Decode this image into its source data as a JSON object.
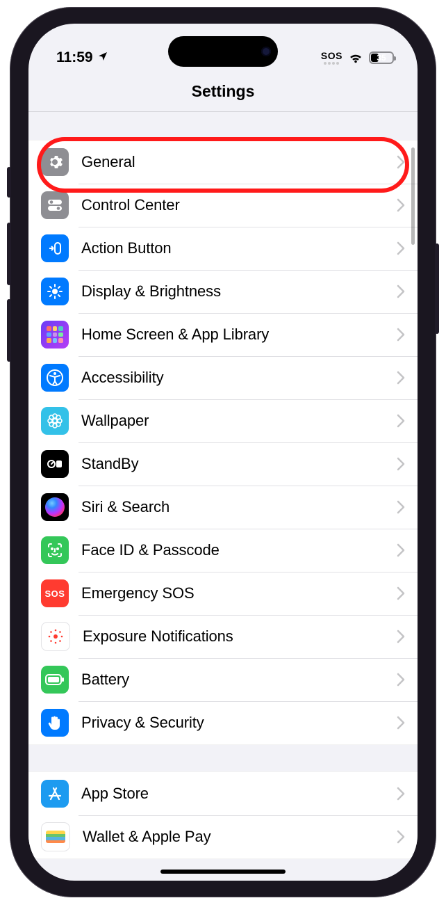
{
  "status": {
    "time": "11:59",
    "sos": "SOS",
    "battery_pct": "35"
  },
  "nav": {
    "title": "Settings"
  },
  "groups": [
    {
      "id": "main",
      "rows": [
        {
          "id": "general",
          "label": "General"
        },
        {
          "id": "control-center",
          "label": "Control Center"
        },
        {
          "id": "action-button",
          "label": "Action Button"
        },
        {
          "id": "display",
          "label": "Display & Brightness"
        },
        {
          "id": "home-screen",
          "label": "Home Screen & App Library"
        },
        {
          "id": "accessibility",
          "label": "Accessibility"
        },
        {
          "id": "wallpaper",
          "label": "Wallpaper"
        },
        {
          "id": "standby",
          "label": "StandBy"
        },
        {
          "id": "siri",
          "label": "Siri & Search"
        },
        {
          "id": "faceid",
          "label": "Face ID & Passcode"
        },
        {
          "id": "sos",
          "label": "Emergency SOS"
        },
        {
          "id": "exposure",
          "label": "Exposure Notifications"
        },
        {
          "id": "battery",
          "label": "Battery"
        },
        {
          "id": "privacy",
          "label": "Privacy & Security"
        }
      ]
    },
    {
      "id": "store",
      "rows": [
        {
          "id": "appstore",
          "label": "App Store"
        },
        {
          "id": "wallet",
          "label": "Wallet & Apple Pay"
        }
      ]
    }
  ],
  "highlight_row": "general"
}
